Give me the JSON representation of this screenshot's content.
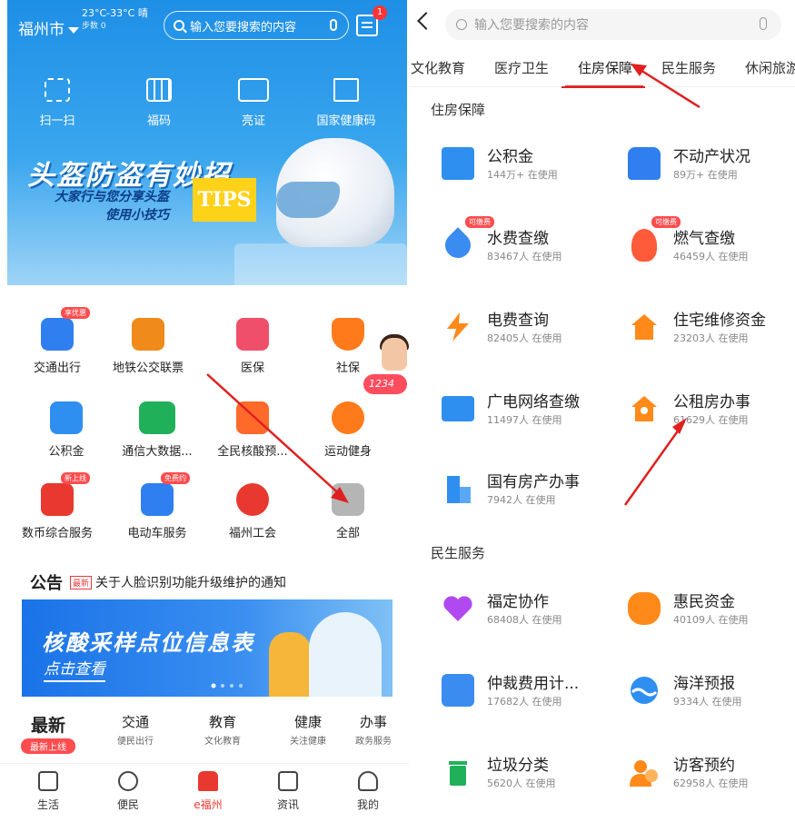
{
  "left": {
    "header": {
      "city": "福州市",
      "temperature": "23°C-33°C 晴",
      "steps": "步数 0",
      "search_placeholder": "输入您要搜索的内容",
      "message_badge": "1"
    },
    "quick_actions": [
      {
        "label": "扫一扫",
        "icon": "scan-icon"
      },
      {
        "label": "福码",
        "icon": "qr-code-icon"
      },
      {
        "label": "亮证",
        "icon": "id-card-icon"
      },
      {
        "label": "国家健康码",
        "icon": "health-code-icon"
      }
    ],
    "banner": {
      "title": "头盔防盗有妙招",
      "sub1": "大家行与您分享头盔",
      "sub2": "使用小技巧",
      "tips": "TIPS"
    },
    "grid": [
      {
        "label": "交通出行",
        "tag": "享优惠",
        "color": "#2f7ff0"
      },
      {
        "label": "地铁公交联票",
        "tag": "",
        "color": "#f08a1a"
      },
      {
        "label": "医保",
        "tag": "",
        "color": "#f04f6a"
      },
      {
        "label": "社保",
        "tag": "",
        "color": "#ff7a1a"
      },
      {
        "label": "公积金",
        "tag": "",
        "color": "#2f8ff0"
      },
      {
        "label": "通信大数据...",
        "tag": "",
        "color": "#21b05a"
      },
      {
        "label": "全民核酸预...",
        "tag": "",
        "color": "#ff6a2a"
      },
      {
        "label": "运动健身",
        "tag": "",
        "color": "#ff7a1a"
      },
      {
        "label": "数币综合服务",
        "tag": "新上线",
        "color": "#e8382f"
      },
      {
        "label": "电动车服务",
        "tag": "免费约",
        "color": "#2f7ff0"
      },
      {
        "label": "福州工会",
        "tag": "",
        "color": "#e8382f"
      },
      {
        "label": "全部",
        "tag": "",
        "color": "#9a9a9a"
      }
    ],
    "side_pill": "1234",
    "notice": {
      "label": "公告",
      "badge": "最新",
      "text": "关于人脸识别功能升级维护的通知"
    },
    "ad": {
      "title": "核酸采样点位信息表",
      "link": "点击查看"
    },
    "categories": [
      {
        "title": "最新",
        "sub": "最新上线"
      },
      {
        "title": "交通",
        "sub": "便民出行"
      },
      {
        "title": "教育",
        "sub": "文化教育"
      },
      {
        "title": "健康",
        "sub": "关注健康"
      },
      {
        "title": "办事",
        "sub": "政务服务"
      }
    ],
    "tabbar": [
      {
        "label": "生活",
        "icon": "life-icon"
      },
      {
        "label": "便民",
        "icon": "compass-icon"
      },
      {
        "label": "e福州",
        "icon": "home-icon"
      },
      {
        "label": "资讯",
        "icon": "news-icon"
      },
      {
        "label": "我的",
        "icon": "user-icon"
      }
    ]
  },
  "right": {
    "search_placeholder": "输入您要搜索的内容",
    "tabs": [
      "文化教育",
      "医疗卫生",
      "住房保障",
      "民生服务",
      "休闲旅游"
    ],
    "active_tab": "住房保障",
    "sections": [
      {
        "title": "住房保障",
        "items": [
          {
            "name": "公积金",
            "usage": "144万+ 在使用",
            "tag": "",
            "color": "#2f8ff0",
            "icon": "yuan-card-icon"
          },
          {
            "name": "不动产状况",
            "usage": "89万+ 在使用",
            "tag": "",
            "color": "#2f7ff0",
            "icon": "building-icon"
          },
          {
            "name": "水费查缴",
            "usage": "83467人 在使用",
            "tag": "可缴费",
            "color": "#3b8cf0",
            "icon": "water-drop-icon"
          },
          {
            "name": "燃气查缴",
            "usage": "46459人 在使用",
            "tag": "可缴费",
            "color": "#ff5a3a",
            "icon": "flame-icon"
          },
          {
            "name": "电费查询",
            "usage": "82405人 在使用",
            "tag": "",
            "color": "#ff8a1a",
            "icon": "lightning-icon"
          },
          {
            "name": "住宅维修资金",
            "usage": "23203人 在使用",
            "tag": "",
            "color": "#ff8a1a",
            "icon": "house-repair-icon"
          },
          {
            "name": "广电网络查缴",
            "usage": "11497人 在使用",
            "tag": "",
            "color": "#2f8ff0",
            "icon": "tv-icon"
          },
          {
            "name": "公租房办事",
            "usage": "61629人 在使用",
            "tag": "",
            "color": "#ff8a1a",
            "icon": "house-key-icon"
          },
          {
            "name": "国有房产办事",
            "usage": "7942人 在使用",
            "tag": "",
            "color": "#2f8ff0",
            "icon": "office-building-icon"
          }
        ]
      },
      {
        "title": "民生服务",
        "items": [
          {
            "name": "福定协作",
            "usage": "68408人 在使用",
            "tag": "",
            "color": "#b04af0",
            "icon": "heart-hands-icon"
          },
          {
            "name": "惠民资金",
            "usage": "40109人 在使用",
            "tag": "",
            "color": "#ff8a1a",
            "icon": "money-bag-icon"
          },
          {
            "name": "仲裁费用计...",
            "usage": "17682人 在使用",
            "tag": "",
            "color": "#3b8cf0",
            "icon": "calculator-icon"
          },
          {
            "name": "海洋预报",
            "usage": "9334人 在使用",
            "tag": "",
            "color": "#2f8ff0",
            "icon": "wave-icon"
          },
          {
            "name": "垃圾分类",
            "usage": "5620人 在使用",
            "tag": "",
            "color": "#21b05a",
            "icon": "recycle-bin-icon"
          },
          {
            "name": "访客预约",
            "usage": "62958人 在使用",
            "tag": "",
            "color": "#ff8a1a",
            "icon": "visitor-icon"
          }
        ]
      }
    ]
  },
  "colors": {
    "accent": "#e53935",
    "blue": "#1e8fe6"
  }
}
